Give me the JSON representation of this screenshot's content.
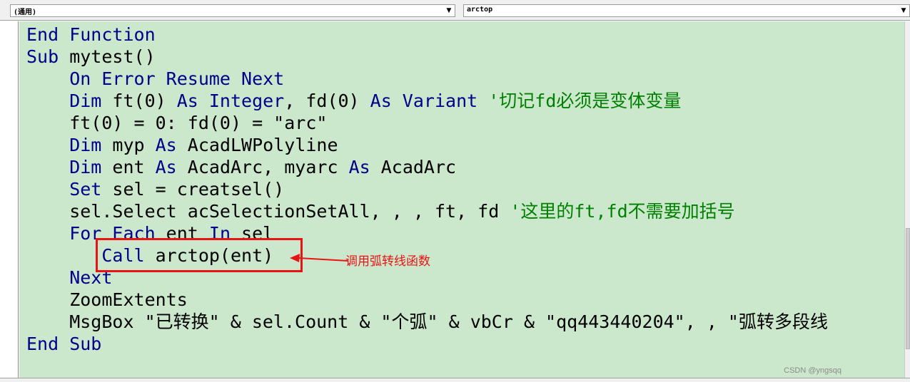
{
  "toolbar": {
    "object_combo": "(通用)",
    "procedure_combo": "arctop"
  },
  "code_lines": [
    [
      {
        "t": "End Function",
        "c": "kw"
      }
    ],
    [
      {
        "t": "Sub",
        "c": "kw"
      },
      {
        "t": " mytest()",
        "c": ""
      }
    ],
    [
      {
        "t": "    On Error Resume Next",
        "c": "kw"
      }
    ],
    [
      {
        "t": "    Dim",
        "c": "kw"
      },
      {
        "t": " ft(0) ",
        "c": ""
      },
      {
        "t": "As Integer",
        "c": "kw"
      },
      {
        "t": ", fd(0) ",
        "c": ""
      },
      {
        "t": "As Variant",
        "c": "kw"
      },
      {
        "t": " '切记fd必须是变体变量",
        "c": "cm"
      }
    ],
    [
      {
        "t": "    ft(0) = 0: fd(0) = \"arc\"",
        "c": ""
      }
    ],
    [
      {
        "t": "    Dim",
        "c": "kw"
      },
      {
        "t": " myp ",
        "c": ""
      },
      {
        "t": "As",
        "c": "kw"
      },
      {
        "t": " AcadLWPolyline",
        "c": ""
      }
    ],
    [
      {
        "t": "    Dim",
        "c": "kw"
      },
      {
        "t": " ent ",
        "c": ""
      },
      {
        "t": "As",
        "c": "kw"
      },
      {
        "t": " AcadArc, myarc ",
        "c": ""
      },
      {
        "t": "As",
        "c": "kw"
      },
      {
        "t": " AcadArc",
        "c": ""
      }
    ],
    [
      {
        "t": "    Set",
        "c": "kw"
      },
      {
        "t": " sel = creatsel()",
        "c": ""
      }
    ],
    [
      {
        "t": "    sel.Select acSelectionSetAll, , , ft, fd ",
        "c": ""
      },
      {
        "t": "'这里的ft,fd不需要加括号",
        "c": "cm"
      }
    ],
    [
      {
        "t": "    For Each",
        "c": "kw"
      },
      {
        "t": " ent ",
        "c": ""
      },
      {
        "t": "In",
        "c": "kw"
      },
      {
        "t": " sel",
        "c": ""
      }
    ],
    [
      {
        "t": "       Call",
        "c": "kw"
      },
      {
        "t": " arctop(ent)",
        "c": ""
      }
    ],
    [
      {
        "t": "    Next",
        "c": "kw"
      }
    ],
    [
      {
        "t": "    ZoomExtents",
        "c": ""
      }
    ],
    [
      {
        "t": "    MsgBox \"已转换\" & sel.Count & \"个弧\" & vbCr & \"qq443440204\", , \"弧转多段线",
        "c": ""
      }
    ],
    [
      {
        "t": "End Sub",
        "c": "kw"
      }
    ]
  ],
  "annotation": {
    "label": "调用弧转线函数",
    "color": "#e81414"
  },
  "watermark": "CSDN @yngsqq",
  "colors": {
    "editor_bg": "#cce8cc",
    "keyword": "#00008b",
    "comment": "#008000"
  }
}
